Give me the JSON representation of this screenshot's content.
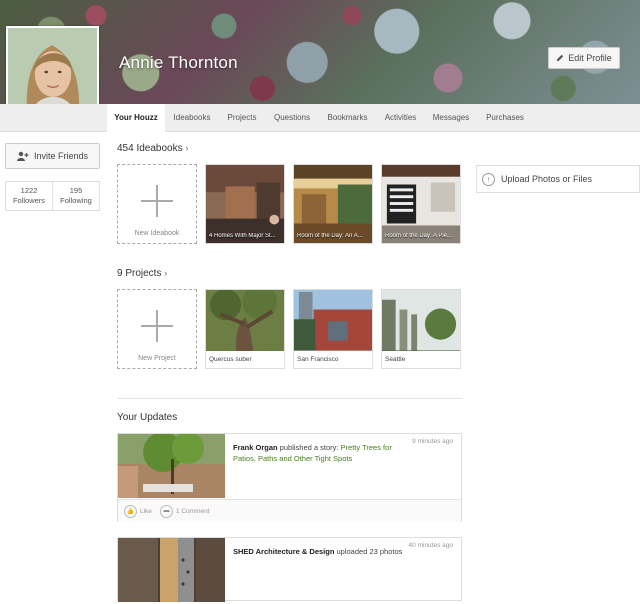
{
  "profile": {
    "name": "Annie Thornton",
    "edit_label": "Edit Profile"
  },
  "nav": {
    "tabs": [
      {
        "label": "Your Houzz",
        "active": true
      },
      {
        "label": "Ideabooks"
      },
      {
        "label": "Projects"
      },
      {
        "label": "Questions"
      },
      {
        "label": "Bookmarks"
      },
      {
        "label": "Activities"
      },
      {
        "label": "Messages"
      },
      {
        "label": "Purchases"
      }
    ]
  },
  "sidebar": {
    "invite_label": "Invite Friends",
    "followers_count": "1222",
    "followers_label": "Followers",
    "following_count": "195",
    "following_label": "Following"
  },
  "ideabooks": {
    "title": "454 Ideabooks",
    "new_label": "New Ideabook",
    "items": [
      {
        "caption": "4 Homes With Major St..."
      },
      {
        "caption": "Room of the Day: An A..."
      },
      {
        "caption": "Room of the Day: A Pie..."
      }
    ]
  },
  "projects": {
    "title": "9 Projects",
    "new_label": "New Project",
    "items": [
      {
        "caption": "Quercus suber"
      },
      {
        "caption": "San Francisco"
      },
      {
        "caption": "Seattle"
      }
    ]
  },
  "upload": {
    "label": "Upload Photos or Files"
  },
  "updates": {
    "title": "Your Updates",
    "items": [
      {
        "author": "Frank Organ",
        "action": " published a story: ",
        "link": "Pretty Trees for Patios, Paths and Other Tight Spots",
        "time": "9 minutes ago",
        "like_label": "Like",
        "comment_label": "1 Comment"
      },
      {
        "author": "SHED Architecture & Design",
        "action": " uploaded 23 photos",
        "link": "",
        "time": "40 minutes ago"
      }
    ]
  },
  "icons": {
    "edit": "pencil-icon",
    "invite": "add-person-icon",
    "chevron": "chevron-right-icon",
    "upload": "upload-arrow-icon",
    "like": "thumbs-up-icon",
    "comment": "speech-bubble-icon"
  },
  "colors": {
    "link_green": "#4a7d21",
    "nav_bg": "#eeeeee"
  }
}
